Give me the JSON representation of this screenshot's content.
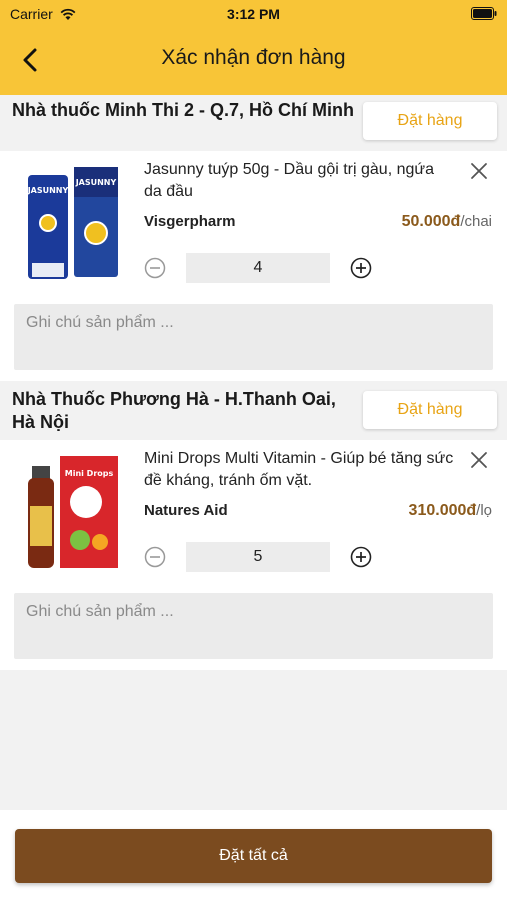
{
  "status_bar": {
    "carrier": "Carrier",
    "time": "3:12 PM"
  },
  "nav": {
    "title": "Xác nhận đơn hàng"
  },
  "stores": [
    {
      "name": "Nhà thuốc Minh Thi 2 - Q.7, Hồ Chí Minh",
      "order_label": "Đặt hàng",
      "product": {
        "name": "Jasunny tuýp 50g - Dầu gội trị gàu, ngứa da đầu",
        "brand": "Visgerpharm",
        "price": "50.000đ",
        "unit": "/chai",
        "quantity": "4",
        "note_placeholder": "Ghi chú sản phẩm ...",
        "image_text": "JASUNNY"
      }
    },
    {
      "name": "Nhà Thuốc Phương Hà - H.Thanh Oai, Hà Nội",
      "order_label": "Đặt hàng",
      "product": {
        "name": "Mini Drops Multi Vitamin - Giúp bé tăng sức đề kháng, tránh ốm vặt.",
        "brand": "Natures Aid",
        "price": "310.000đ",
        "unit": "/lọ",
        "quantity": "5",
        "note_placeholder": "Ghi chú sản phẩm ...",
        "image_text": "Mini Drops"
      }
    }
  ],
  "footer": {
    "order_all_label": "Đặt tất cả"
  },
  "colors": {
    "header": "#f8c537",
    "accent_text": "#e8a415",
    "price": "#8b5a1c",
    "primary_button": "#7b4b1f"
  },
  "icons": {
    "back": "chevron-left-icon",
    "close": "close-icon",
    "minus": "minus-circle-icon",
    "plus": "plus-circle-icon",
    "wifi": "wifi-icon",
    "battery": "battery-icon"
  }
}
